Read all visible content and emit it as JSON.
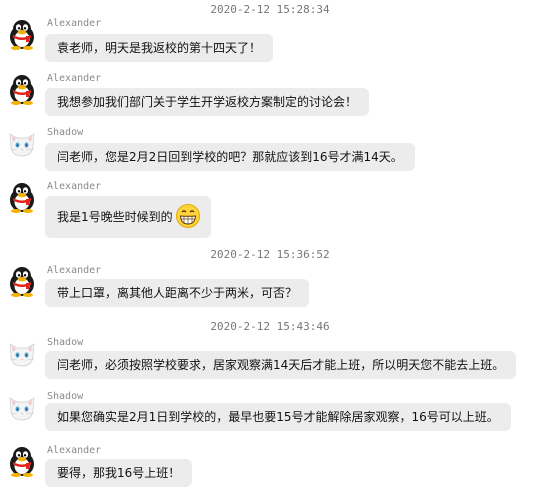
{
  "timestamps": [
    "2020-2-12 15:28:34",
    "2020-2-12 15:36:52",
    "2020-2-12 15:43:46"
  ],
  "messages": [
    {
      "sender": "Alexander",
      "text": "袁老师，明天是我返校的第十四天了！"
    },
    {
      "sender": "Alexander",
      "text": "我想参加我们部门关于学生开学返校方案制定的讨论会！"
    },
    {
      "sender": "Shadow",
      "text": "闫老师，您是2月2日回到学校的吧？那就应该到16号才满14天。"
    },
    {
      "sender": "Alexander",
      "text": "我是1号晚些时候到的"
    },
    {
      "sender": "Alexander",
      "text": "带上口罩，离其他人距离不少于两米，可否？"
    },
    {
      "sender": "Shadow",
      "text": "闫老师，必须按照学校要求，居家观察满14天后才能上班，所以明天您不能去上班。"
    },
    {
      "sender": "Shadow",
      "text": "如果您确实是2月1日到学校的，最早也要15号才能解除居家观察，16号可以上班。"
    },
    {
      "sender": "Alexander",
      "text": "要得，那我16号上班！"
    }
  ]
}
